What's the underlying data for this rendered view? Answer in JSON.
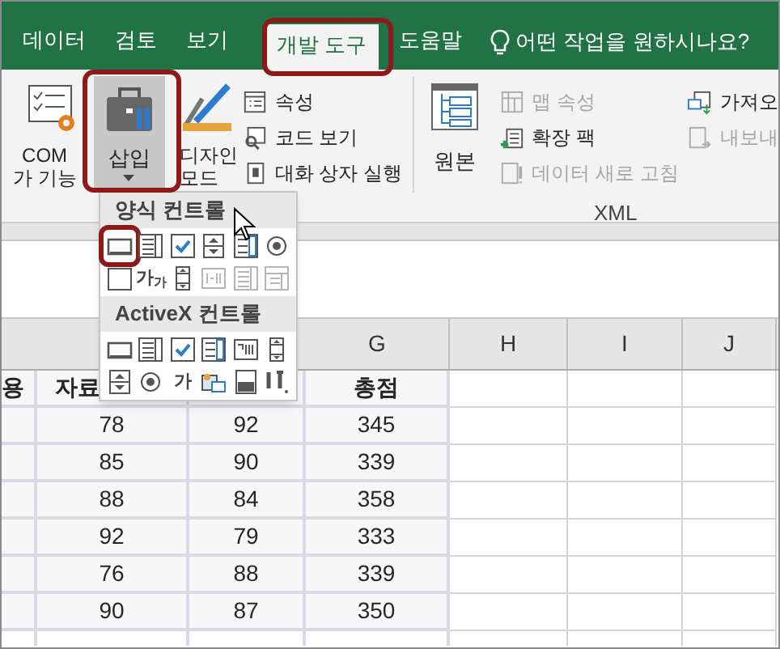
{
  "tabs": [
    {
      "label": "데이터",
      "selected": false
    },
    {
      "label": "검토",
      "selected": false
    },
    {
      "label": "보기",
      "selected": false
    },
    {
      "label": "개발 도구",
      "selected": true
    },
    {
      "label": "도움말",
      "selected": false
    }
  ],
  "tell_me": {
    "placeholder": "어떤 작업을 원하시나요?"
  },
  "ribbon": {
    "com_addins": {
      "line_1": "COM",
      "line_2": "가 기능"
    },
    "insert": {
      "label": "삽입",
      "highlighted": true
    },
    "design_mode": {
      "line_1": "디자인",
      "line_2": "모드"
    },
    "controls": [
      {
        "kind": "properties",
        "label": "속성",
        "disabled": false
      },
      {
        "kind": "code",
        "label": "코드 보기",
        "disabled": false
      },
      {
        "kind": "dialog",
        "label": "대화 상자 실행",
        "disabled": false
      }
    ],
    "xml": {
      "source": "원본",
      "title": "XML",
      "column_1": [
        {
          "kind": "map",
          "label": "맵 속성",
          "disabled": true
        },
        {
          "kind": "pack",
          "label": "확장 팩",
          "disabled": false
        },
        {
          "kind": "refresh",
          "label": "데이터 새로 고침",
          "disabled": true
        }
      ],
      "column_2": [
        {
          "kind": "import",
          "label": "가져오",
          "disabled": false
        },
        {
          "kind": "export",
          "label": "내보내",
          "disabled": true
        }
      ]
    }
  },
  "insert_menu": {
    "sections": [
      {
        "title": "양식 컨트롤",
        "items": [
          {
            "kind": "button",
            "selected": true,
            "disabled": false
          },
          {
            "kind": "combo",
            "selected": false,
            "disabled": false
          },
          {
            "kind": "checkbox",
            "selected": false,
            "disabled": false
          },
          {
            "kind": "spin",
            "selected": false,
            "disabled": false
          },
          {
            "kind": "listbox",
            "selected": false,
            "disabled": false
          },
          {
            "kind": "radio",
            "selected": false,
            "disabled": false
          },
          {
            "kind": "groupbox",
            "selected": false,
            "disabled": false
          },
          {
            "kind": "label",
            "glyph": "가$_{가}$",
            "selected": false,
            "disabled": false
          },
          {
            "kind": "scrollbar",
            "selected": false,
            "disabled": false
          },
          {
            "kind": "textfield",
            "selected": false,
            "disabled": true
          },
          {
            "kind": "combolist",
            "selected": false,
            "disabled": true
          },
          {
            "kind": "combodrop",
            "selected": false,
            "disabled": true
          }
        ]
      },
      {
        "title": "ActiveX 컨트롤",
        "items": [
          {
            "kind": "button",
            "selected": false,
            "disabled": false
          },
          {
            "kind": "combo",
            "selected": false,
            "disabled": false
          },
          {
            "kind": "checkbox",
            "selected": false,
            "disabled": false
          },
          {
            "kind": "listbox",
            "selected": false,
            "disabled": false
          },
          {
            "kind": "textbox",
            "selected": false,
            "disabled": false
          },
          {
            "kind": "scrollbar",
            "selected": false,
            "disabled": false
          },
          {
            "kind": "spin",
            "selected": false,
            "disabled": false
          },
          {
            "kind": "radio",
            "selected": false,
            "disabled": false
          },
          {
            "kind": "label",
            "glyph": "가",
            "selected": false,
            "disabled": false
          },
          {
            "kind": "image",
            "selected": false,
            "disabled": false
          },
          {
            "kind": "toggle",
            "selected": false,
            "disabled": false
          },
          {
            "kind": "more",
            "selected": false,
            "disabled": false
          }
        ]
      }
    ]
  },
  "sheet": {
    "column_letters": {
      "column_4": "G",
      "column_5": "H",
      "column_6": "I",
      "column_7": "J"
    },
    "header_row": {
      "column_1": "용",
      "column_2": "자료",
      "column_4": "총점"
    },
    "rows": [
      {
        "column_2": "78",
        "column_3": "92",
        "column_4": "345"
      },
      {
        "column_2": "85",
        "column_3": "90",
        "column_4": "339"
      },
      {
        "column_2": "88",
        "column_3": "84",
        "column_4": "358"
      },
      {
        "column_2": "92",
        "column_3": "79",
        "column_4": "333"
      },
      {
        "column_2": "76",
        "column_3": "88",
        "column_4": "339"
      },
      {
        "column_2": "90",
        "column_3": "87",
        "column_4": "350"
      }
    ]
  }
}
